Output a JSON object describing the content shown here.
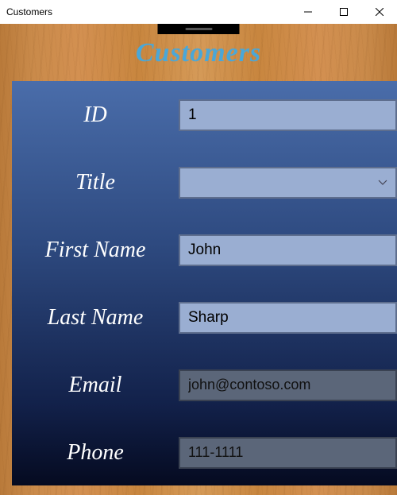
{
  "window": {
    "title": "Customers"
  },
  "heading": "Customers",
  "form": {
    "id": {
      "label": "ID",
      "value": "1"
    },
    "title": {
      "label": "Title",
      "value": ""
    },
    "firstName": {
      "label": "First Name",
      "value": "John"
    },
    "lastName": {
      "label": "Last Name",
      "value": "Sharp"
    },
    "email": {
      "label": "Email",
      "value": "john@contoso.com"
    },
    "phone": {
      "label": "Phone",
      "value": "111-1111"
    }
  }
}
